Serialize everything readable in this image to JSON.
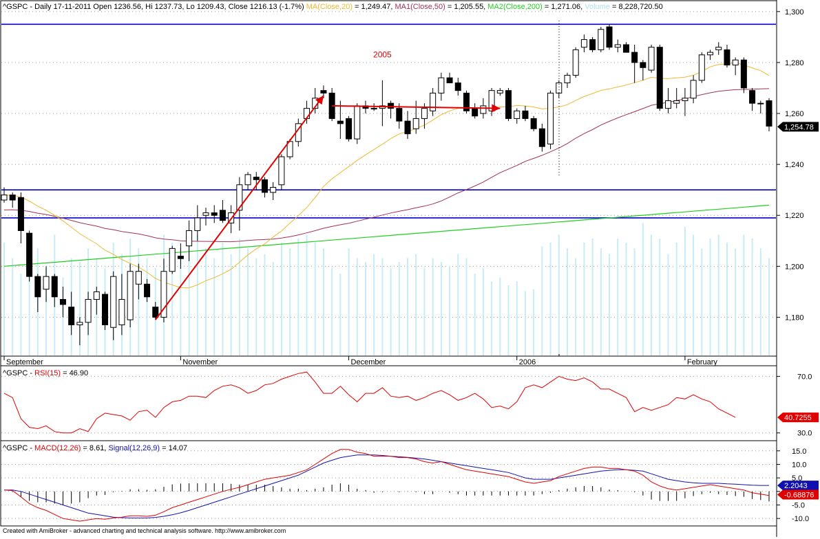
{
  "colors": {
    "background": "#ffffff",
    "border": "#000000",
    "grid": "#9a9a9a",
    "volume": "#c6ecf4",
    "candle": "#000000",
    "ma20": "#f0b830",
    "ma50": "#a0305a",
    "ma200": "#1fcf1f",
    "hline": "#0000c8",
    "arrow": "#e00000",
    "rsi": "#e00000",
    "macd": "#e00000",
    "signal": "#1010b0",
    "histogram": "#000000"
  },
  "footer": "Created with AmiBroker - advanced charting and technical analysis software. http://www.amibroker.com",
  "chart_data": [
    {
      "type": "candlestick",
      "title": {
        "prefix": "^GSPC - Daily 17-11-2011 Open 1236.56, Hi 1237.73, Lo 1209.43, Close 1216.13 (-1.7%) ",
        "ma20": "MA(Close,20)",
        "ma20_value": " = 1,249.47, ",
        "ma50": "MA1(Close,50)",
        "ma50_value": " = 1,205.55, ",
        "ma200": "MA2(Close,200)",
        "ma200_value": " = 1,271.06, ",
        "volume": "Volume",
        "volume_value": " = 8,228,720.50"
      },
      "ylim": [
        1165,
        1304
      ],
      "y_ticks": [
        1180,
        1200,
        1220,
        1240,
        1260,
        1280,
        1300
      ],
      "y_tick_labels": [
        "1,180",
        "1,200",
        "1,220",
        "1,240",
        "1,260",
        "1,280",
        "1,300"
      ],
      "last_value_label": "1,254.78",
      "last_value": 1254.78,
      "x_ticks": [
        {
          "index": 0,
          "label": "September"
        },
        {
          "index": 21,
          "label": "November"
        },
        {
          "index": 41,
          "label": "December"
        },
        {
          "index": 61,
          "label": "2006"
        },
        {
          "index": 81,
          "label": "February"
        }
      ],
      "annotation": {
        "text": "2005",
        "index": 45,
        "y": 1282
      },
      "horizontal_lines": [
        1295,
        1230,
        1219
      ],
      "trend_arrows": [
        {
          "from": [
            18,
            1179
          ],
          "to": [
            38,
            1267
          ]
        },
        {
          "from": [
            39,
            1263
          ],
          "to": [
            59,
            1262
          ]
        }
      ],
      "ohlc": [
        [
          1226,
          1231,
          1225,
          1228
        ],
        [
          1228,
          1229,
          1223,
          1226
        ],
        [
          1227,
          1229,
          1209,
          1214
        ],
        [
          1213,
          1214,
          1194,
          1196
        ],
        [
          1196,
          1197,
          1182,
          1188
        ],
        [
          1191,
          1200,
          1186,
          1196
        ],
        [
          1196,
          1197,
          1184,
          1188
        ],
        [
          1187,
          1192,
          1180,
          1185
        ],
        [
          1184,
          1190,
          1173,
          1177
        ],
        [
          1177,
          1180,
          1169,
          1178
        ],
        [
          1178,
          1190,
          1173,
          1187
        ],
        [
          1187,
          1192,
          1181,
          1190
        ],
        [
          1189,
          1190,
          1175,
          1177
        ],
        [
          1176,
          1198,
          1171,
          1196
        ],
        [
          1177,
          1197,
          1173,
          1187
        ],
        [
          1179,
          1201,
          1176,
          1198
        ],
        [
          1193,
          1201,
          1187,
          1198
        ],
        [
          1193,
          1195,
          1186,
          1188
        ],
        [
          1184,
          1186,
          1179,
          1180
        ],
        [
          1180,
          1203,
          1178,
          1198
        ],
        [
          1198,
          1208,
          1197,
          1207
        ],
        [
          1204,
          1209,
          1199,
          1203
        ],
        [
          1208,
          1218,
          1202,
          1214
        ],
        [
          1214,
          1224,
          1210,
          1219
        ],
        [
          1220,
          1223,
          1216,
          1221
        ],
        [
          1221,
          1224,
          1217,
          1220
        ],
        [
          1222,
          1226,
          1217,
          1218
        ],
        [
          1217,
          1224,
          1213,
          1221
        ],
        [
          1222,
          1235,
          1214,
          1232
        ],
        [
          1232,
          1237,
          1230,
          1236
        ],
        [
          1235,
          1237,
          1230,
          1234
        ],
        [
          1234,
          1235,
          1227,
          1229
        ],
        [
          1229,
          1233,
          1226,
          1231
        ],
        [
          1232,
          1244,
          1230,
          1243
        ],
        [
          1243,
          1250,
          1242,
          1249
        ],
        [
          1249,
          1258,
          1247,
          1256
        ],
        [
          1258,
          1265,
          1256,
          1262
        ],
        [
          1262,
          1270,
          1260,
          1266
        ],
        [
          1269,
          1271,
          1266,
          1268
        ],
        [
          1268,
          1270,
          1257,
          1258
        ],
        [
          1257,
          1265,
          1250,
          1256
        ],
        [
          1258,
          1259,
          1249,
          1250
        ],
        [
          1250,
          1264,
          1248,
          1263
        ],
        [
          1263,
          1265,
          1260,
          1262
        ],
        [
          1262,
          1264,
          1261,
          1262
        ],
        [
          1262,
          1273,
          1255,
          1263
        ],
        [
          1264,
          1265,
          1258,
          1262
        ],
        [
          1262,
          1264,
          1254,
          1257
        ],
        [
          1257,
          1261,
          1250,
          1252
        ],
        [
          1254,
          1265,
          1252,
          1258
        ],
        [
          1258,
          1264,
          1254,
          1262
        ],
        [
          1261,
          1270,
          1259,
          1268
        ],
        [
          1268,
          1276,
          1265,
          1274
        ],
        [
          1274,
          1276,
          1272,
          1272
        ],
        [
          1272,
          1274,
          1267,
          1269
        ],
        [
          1268,
          1269,
          1260,
          1261
        ],
        [
          1262,
          1264,
          1258,
          1259
        ],
        [
          1260,
          1266,
          1258,
          1263
        ],
        [
          1261,
          1270,
          1259,
          1269
        ],
        [
          1268,
          1270,
          1267,
          1269
        ],
        [
          1269,
          1270,
          1257,
          1258
        ],
        [
          1258,
          1262,
          1256,
          1261
        ],
        [
          1261,
          1263,
          1257,
          1258
        ],
        [
          1258,
          1259,
          1253,
          1254
        ],
        [
          1254,
          1256,
          1245,
          1247
        ],
        [
          1248,
          1269,
          1246,
          1268
        ],
        [
          1268,
          1273,
          1266,
          1272
        ],
        [
          1272,
          1276,
          1270,
          1275
        ],
        [
          1275,
          1286,
          1274,
          1285
        ],
        [
          1286,
          1291,
          1284,
          1289
        ],
        [
          1289,
          1290,
          1284,
          1285
        ],
        [
          1285,
          1294,
          1284,
          1293
        ],
        [
          1294,
          1295,
          1285,
          1286
        ],
        [
          1286,
          1289,
          1284,
          1287
        ],
        [
          1287,
          1288,
          1284,
          1284
        ],
        [
          1284,
          1287,
          1272,
          1280
        ],
        [
          1280,
          1281,
          1273,
          1278
        ],
        [
          1277,
          1287,
          1276,
          1286
        ],
        [
          1286,
          1287,
          1261,
          1262
        ],
        [
          1262,
          1270,
          1260,
          1265
        ],
        [
          1264,
          1270,
          1262,
          1265
        ],
        [
          1265,
          1270,
          1259,
          1266
        ],
        [
          1266,
          1275,
          1264,
          1273
        ],
        [
          1273,
          1284,
          1272,
          1283
        ],
        [
          1283,
          1285,
          1281,
          1284
        ],
        [
          1285,
          1288,
          1283,
          1286
        ],
        [
          1285,
          1287,
          1278,
          1279
        ],
        [
          1279,
          1282,
          1275,
          1281
        ],
        [
          1281,
          1282,
          1268,
          1270
        ],
        [
          1269,
          1270,
          1261,
          1264
        ],
        [
          1264,
          1265,
          1260,
          1264
        ],
        [
          1265,
          1266,
          1253,
          1255
        ]
      ],
      "volume": [
        0.58,
        0.5,
        0.42,
        0.6,
        0.55,
        0.45,
        0.62,
        0.4,
        0.5,
        0.48,
        0.55,
        0.5,
        0.45,
        0.58,
        0.52,
        0.6,
        0.55,
        0.5,
        0.45,
        0.62,
        0.58,
        0.55,
        0.6,
        0.62,
        0.55,
        0.5,
        0.58,
        0.52,
        0.6,
        0.55,
        0.5,
        0.52,
        0.48,
        0.58,
        0.55,
        0.6,
        0.62,
        0.58,
        0.55,
        0.45,
        0.42,
        0.55,
        0.5,
        0.48,
        0.52,
        0.5,
        0.45,
        0.48,
        0.5,
        0.52,
        0.45,
        0.5,
        0.48,
        0.46,
        0.52,
        0.5,
        0.42,
        0.45,
        0.38,
        0.4,
        0.36,
        0.38,
        0.33,
        0.34,
        0.56,
        0.58,
        0.62,
        0.55,
        0.5,
        0.58,
        0.6,
        0.55,
        0.52,
        0.6,
        0.58,
        0.55,
        0.68,
        0.62,
        0.6,
        0.52,
        0.58,
        0.66,
        0.62,
        0.55,
        0.6,
        0.62,
        0.58,
        0.55,
        0.62,
        0.6,
        0.55,
        0.5
      ]
    },
    {
      "type": "line",
      "title": {
        "prefix": "^GSPC - ",
        "series": "RSI(15)",
        "value": " = 46.90"
      },
      "ylim": [
        25,
        77
      ],
      "y_ticks": [
        30,
        70
      ],
      "y_tick_labels": [
        "30.0",
        "70.0"
      ],
      "last_value_label": "40.7255",
      "last_value": 41,
      "values": [
        58,
        55,
        40,
        34,
        33,
        35,
        31,
        30,
        30,
        33,
        31,
        40,
        44,
        43,
        42,
        39,
        45,
        46,
        41,
        48,
        52,
        53,
        56,
        56,
        55,
        60,
        63,
        64,
        62,
        58,
        60,
        64,
        65,
        68,
        70,
        72,
        73,
        66,
        58,
        58,
        63,
        57,
        52,
        58,
        58,
        62,
        56,
        55,
        56,
        53,
        55,
        58,
        60,
        57,
        53,
        55,
        58,
        54,
        48,
        49,
        47,
        52,
        62,
        64,
        62,
        66,
        70,
        68,
        67,
        69,
        66,
        61,
        61,
        58,
        55,
        45,
        48,
        46,
        48,
        50,
        55,
        54,
        57,
        54,
        52,
        47,
        44,
        41
      ]
    },
    {
      "type": "line",
      "title": {
        "prefix": "^GSPC - ",
        "macd": "MACD(12,26)",
        "macd_value": " = 8.61, ",
        "signal": "Signal(12,26,9)",
        "signal_value": " = 14.07"
      },
      "ylim": [
        -12.5,
        18.5
      ],
      "y_ticks": [
        -10,
        -5,
        0,
        5,
        10,
        15
      ],
      "y_tick_labels": [
        "-10.0",
        "-5.0",
        "0.0",
        "5.0",
        "10.0",
        "15.0"
      ],
      "last_value_labels": [
        "2.2043",
        "-0.68876"
      ],
      "last_values": [
        2.2043,
        -0.68876
      ],
      "series": [
        {
          "name": "MACD(12,26)",
          "values": [
            0.5,
            0.3,
            -2,
            -4.5,
            -6,
            -7,
            -8.5,
            -10,
            -10.5,
            -11,
            -10.5,
            -10,
            -10.3,
            -9.8,
            -9.5,
            -9,
            -9,
            -9.2,
            -8.8,
            -7.5,
            -6,
            -5,
            -4,
            -3,
            -2,
            -1,
            0,
            0.8,
            1.5,
            2.5,
            3.5,
            4.5,
            5,
            5.5,
            6,
            7,
            8,
            10,
            12,
            14,
            15.5,
            15.5,
            14.5,
            14,
            13,
            13,
            13,
            12.5,
            12.5,
            12,
            11,
            10.5,
            11,
            10,
            9,
            8,
            7.5,
            7,
            6.5,
            6,
            5.5,
            4.5,
            3.5,
            3,
            3.5,
            4,
            5.5,
            6.5,
            7.5,
            8.5,
            9,
            9,
            8.5,
            8.5,
            8,
            7.5,
            6,
            3.5,
            2,
            1,
            0.5,
            1,
            1.5,
            2,
            2.5,
            2,
            1.5,
            1,
            0.5,
            -0.5,
            -1,
            -1.5
          ]
        },
        {
          "name": "Signal(12,26,9)",
          "values": [
            0.5,
            0.5,
            0,
            -1,
            -2,
            -3,
            -4,
            -5,
            -6,
            -7,
            -8,
            -8.5,
            -9,
            -9.5,
            -9.7,
            -9.8,
            -9.8,
            -9.8,
            -9.6,
            -9.2,
            -8.6,
            -7.9,
            -7,
            -6,
            -5,
            -4,
            -3,
            -2,
            -1,
            0,
            1,
            2,
            3,
            4,
            5,
            6,
            7.5,
            9,
            10.5,
            11.5,
            12.5,
            13,
            13.5,
            13.5,
            13.5,
            13.3,
            13,
            12.8,
            12.6,
            12.3,
            12,
            11.5,
            11,
            10.5,
            10,
            9.5,
            9,
            8.5,
            8,
            7.5,
            7,
            6,
            5,
            4.5,
            4.5,
            4.5,
            5,
            5.5,
            6,
            6.5,
            7,
            7.5,
            7.8,
            8,
            8,
            7.8,
            7.5,
            6.5,
            5.5,
            4.5,
            4,
            3.5,
            3.2,
            3,
            3,
            3,
            2.8,
            2.7,
            2.5,
            2.3,
            2.2,
            2.2
          ]
        }
      ],
      "histogram": [
        0,
        -0.2,
        -2,
        -3.5,
        -4,
        -4,
        -4.5,
        -5,
        -4.5,
        -4,
        -2.5,
        -1.5,
        -1.3,
        -0.3,
        0.2,
        0.8,
        0.8,
        0.6,
        0.8,
        1.7,
        2.6,
        2.9,
        3,
        3,
        3,
        3,
        3,
        2.8,
        2.5,
        2.5,
        2.5,
        2.5,
        2,
        1.5,
        1,
        1,
        0.5,
        1,
        1.5,
        2.5,
        3,
        2.5,
        1,
        0.5,
        -0.5,
        -0.3,
        0,
        -0.3,
        -0.1,
        -0.3,
        -1,
        -1,
        0,
        -0.5,
        -1,
        -1.5,
        -1.5,
        -1.5,
        -1.5,
        -1.5,
        -1.5,
        -1.5,
        -1.5,
        -1.5,
        -1,
        -0.5,
        0.5,
        1,
        1.5,
        2,
        2,
        1.5,
        0.7,
        0.5,
        0,
        -0.3,
        -1.5,
        -3,
        -3.5,
        -3.5,
        -3.5,
        -2.5,
        -1.7,
        -1,
        -0.5,
        -1,
        -1.3,
        -1.7,
        -2,
        -2.8,
        -3.2,
        -3.7
      ]
    }
  ]
}
